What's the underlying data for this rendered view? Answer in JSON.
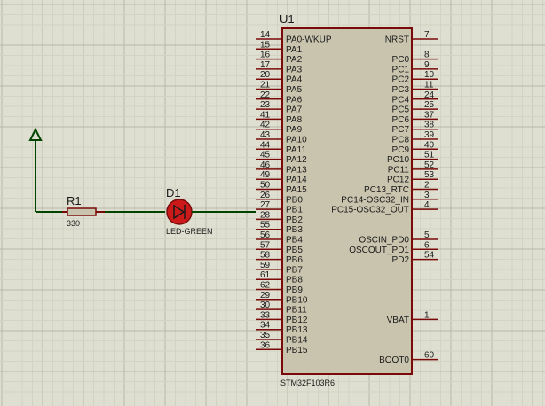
{
  "grid": {
    "major_color": "#b9b9aa",
    "minor_color": "#d3d3c4",
    "background": "#dedfd0"
  },
  "colors": {
    "wire": "#004400",
    "pin": "#7a0a0a",
    "body_fill": "#c8c4ae",
    "body_stroke": "#7a0a0a",
    "led_fill": "#cc1a1a"
  },
  "chip": {
    "ref": "U1",
    "part": "STM32F103R6",
    "left_pins": [
      {
        "num": "14",
        "label": "PA0-WKUP"
      },
      {
        "num": "15",
        "label": "PA1"
      },
      {
        "num": "16",
        "label": "PA2"
      },
      {
        "num": "17",
        "label": "PA3"
      },
      {
        "num": "20",
        "label": "PA4"
      },
      {
        "num": "21",
        "label": "PA5"
      },
      {
        "num": "22",
        "label": "PA6"
      },
      {
        "num": "23",
        "label": "PA7"
      },
      {
        "num": "41",
        "label": "PA8"
      },
      {
        "num": "42",
        "label": "PA9"
      },
      {
        "num": "43",
        "label": "PA10"
      },
      {
        "num": "44",
        "label": "PA11"
      },
      {
        "num": "45",
        "label": "PA12"
      },
      {
        "num": "46",
        "label": "PA13"
      },
      {
        "num": "49",
        "label": "PA14"
      },
      {
        "num": "50",
        "label": "PA15"
      },
      {
        "num": "26",
        "label": "PB0"
      },
      {
        "num": "27",
        "label": "PB1"
      },
      {
        "num": "28",
        "label": "PB2"
      },
      {
        "num": "55",
        "label": "PB3"
      },
      {
        "num": "56",
        "label": "PB4"
      },
      {
        "num": "57",
        "label": "PB5"
      },
      {
        "num": "58",
        "label": "PB6"
      },
      {
        "num": "59",
        "label": "PB7"
      },
      {
        "num": "61",
        "label": "PB8"
      },
      {
        "num": "62",
        "label": "PB9"
      },
      {
        "num": "29",
        "label": "PB10"
      },
      {
        "num": "30",
        "label": "PB11"
      },
      {
        "num": "33",
        "label": "PB12"
      },
      {
        "num": "34",
        "label": "PB13"
      },
      {
        "num": "35",
        "label": "PB14"
      },
      {
        "num": "36",
        "label": "PB15"
      }
    ],
    "right_pins": [
      {
        "num": "7",
        "label": "NRST",
        "row": 0
      },
      {
        "num": "8",
        "label": "PC0",
        "row": 2
      },
      {
        "num": "9",
        "label": "PC1",
        "row": 3
      },
      {
        "num": "10",
        "label": "PC2",
        "row": 4
      },
      {
        "num": "11",
        "label": "PC3",
        "row": 5
      },
      {
        "num": "24",
        "label": "PC4",
        "row": 6
      },
      {
        "num": "25",
        "label": "PC5",
        "row": 7
      },
      {
        "num": "37",
        "label": "PC6",
        "row": 8
      },
      {
        "num": "38",
        "label": "PC7",
        "row": 9
      },
      {
        "num": "39",
        "label": "PC8",
        "row": 10
      },
      {
        "num": "40",
        "label": "PC9",
        "row": 11
      },
      {
        "num": "51",
        "label": "PC10",
        "row": 12
      },
      {
        "num": "52",
        "label": "PC11",
        "row": 13
      },
      {
        "num": "53",
        "label": "PC12",
        "row": 14
      },
      {
        "num": "2",
        "label": "PC13_RTC",
        "row": 15
      },
      {
        "num": "3",
        "label": "PC14-OSC32_IN",
        "row": 16
      },
      {
        "num": "4",
        "label": "PC15-OSC32_OUT",
        "row": 17
      },
      {
        "num": "5",
        "label": "OSCIN_PD0",
        "row": 20
      },
      {
        "num": "6",
        "label": "OSCOUT_PD1",
        "row": 21
      },
      {
        "num": "54",
        "label": "PD2",
        "row": 22
      },
      {
        "num": "1",
        "label": "VBAT",
        "row": 28
      },
      {
        "num": "60",
        "label": "BOOT0",
        "row": 32
      }
    ]
  },
  "resistor": {
    "ref": "R1",
    "value": "330"
  },
  "led": {
    "ref": "D1",
    "value": "LED-GREEN"
  }
}
